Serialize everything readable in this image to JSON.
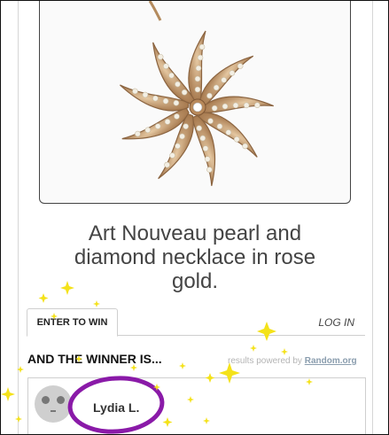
{
  "prize": {
    "image_icon": "star-pearl-necklace-image",
    "title_line1": "Art Nouveau pearl and",
    "title_line2": "diamond necklace in rose",
    "title_line3": "gold."
  },
  "tabs": {
    "enter_label": "ENTER TO WIN",
    "login_label": "LOG IN"
  },
  "winner": {
    "heading": "AND THE WINNER IS...",
    "powered_prefix": "results powered by",
    "powered_link": "Random.org",
    "name": "Lydia L.",
    "avatar_icon": "default-avatar-icon"
  },
  "colors": {
    "circle_highlight": "#8a1aa8",
    "sparkle": "#f4e21a"
  }
}
